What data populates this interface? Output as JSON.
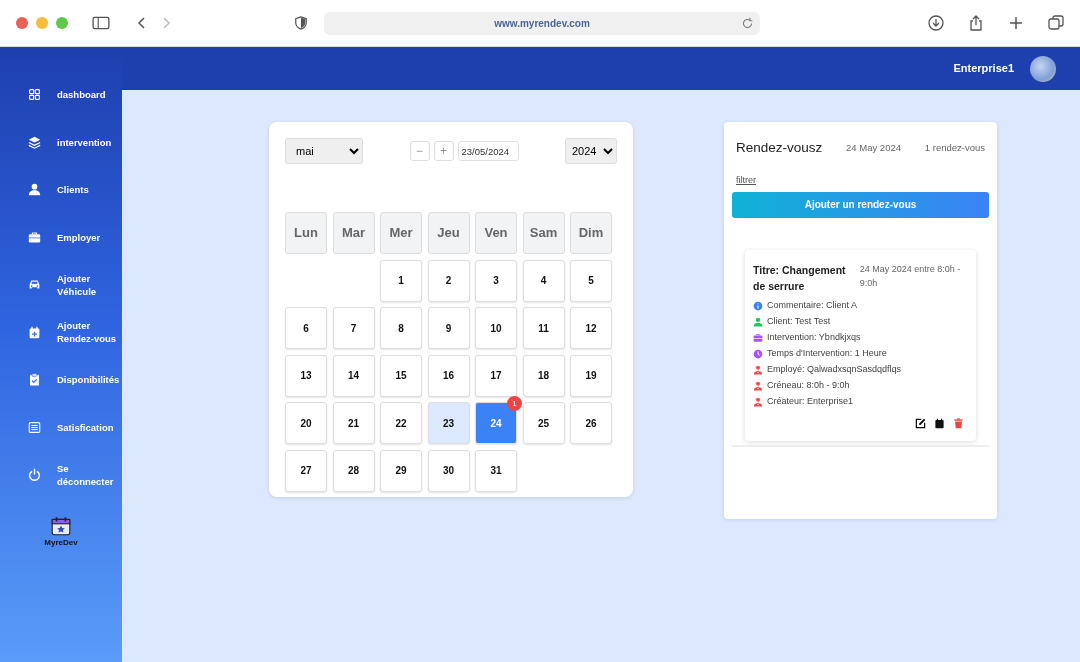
{
  "browser": {
    "url": "www.myrendev.com"
  },
  "header": {
    "user": "Enterprise1"
  },
  "sidebar": {
    "items": [
      {
        "label": "dashboard"
      },
      {
        "label": "intervention"
      },
      {
        "label": "Clients"
      },
      {
        "label": "Employer"
      },
      {
        "label": "Ajouter Véhicule"
      },
      {
        "label": "Ajouter Rendez-vous"
      },
      {
        "label": "Disponibilités"
      },
      {
        "label": "Satisfication"
      },
      {
        "label": "Se déconnecter"
      }
    ],
    "logo_text": "MyreDev"
  },
  "calendar": {
    "month": "mai",
    "date": "23/05/2024",
    "year": "2024",
    "minus": "−",
    "plus": "+",
    "weekdays": [
      "Lun",
      "Mar",
      "Mer",
      "Jeu",
      "Ven",
      "Sam",
      "Dim"
    ],
    "weeks": [
      [
        {
          "kind": "blank"
        },
        {
          "kind": "blank"
        },
        {
          "label": "1",
          "selected": false,
          "highlighted": false
        },
        {
          "label": "2",
          "selected": false,
          "highlighted": false
        },
        {
          "label": "3",
          "selected": false,
          "highlighted": false
        },
        {
          "label": "4",
          "selected": false,
          "highlighted": false
        },
        {
          "label": "5",
          "selected": false,
          "highlighted": false
        }
      ],
      [
        {
          "label": "6",
          "selected": false,
          "highlighted": false
        },
        {
          "label": "7",
          "selected": false,
          "highlighted": false
        },
        {
          "label": "8",
          "selected": false,
          "highlighted": false
        },
        {
          "label": "9",
          "selected": false,
          "highlighted": false
        },
        {
          "label": "10",
          "selected": false,
          "highlighted": false
        },
        {
          "label": "11",
          "selected": false,
          "highlighted": false
        },
        {
          "label": "12",
          "selected": false,
          "highlighted": false
        }
      ],
      [
        {
          "label": "13",
          "selected": false,
          "highlighted": false
        },
        {
          "label": "14",
          "selected": false,
          "highlighted": false
        },
        {
          "label": "15",
          "selected": false,
          "highlighted": false
        },
        {
          "label": "16",
          "selected": false,
          "highlighted": false
        },
        {
          "label": "17",
          "selected": false,
          "highlighted": false
        },
        {
          "label": "18",
          "selected": false,
          "highlighted": false
        },
        {
          "label": "19",
          "selected": false,
          "highlighted": false
        }
      ],
      [
        {
          "label": "20",
          "selected": false,
          "highlighted": false
        },
        {
          "label": "21",
          "selected": false,
          "highlighted": false
        },
        {
          "label": "22",
          "selected": false,
          "highlighted": false
        },
        {
          "label": "23",
          "selected": false,
          "highlighted": true
        },
        {
          "label": "24",
          "selected": true,
          "highlighted": false,
          "badge": "1"
        },
        {
          "label": "25",
          "selected": false,
          "highlighted": false
        },
        {
          "label": "26",
          "selected": false,
          "highlighted": false
        }
      ],
      [
        {
          "label": "27",
          "selected": false,
          "highlighted": false
        },
        {
          "label": "28",
          "selected": false,
          "highlighted": false
        },
        {
          "label": "29",
          "selected": false,
          "highlighted": false
        },
        {
          "label": "30",
          "selected": false,
          "highlighted": false
        },
        {
          "label": "31",
          "selected": false,
          "highlighted": false
        }
      ]
    ]
  },
  "appointments": {
    "title": "Rendez-vousz",
    "date": "24 May 2024",
    "count": "1 rendez-vous",
    "filter": "filtrer",
    "add_button": "Ajouter un rendez-vous",
    "items": [
      {
        "title": "Titre: Changement de serrure",
        "when": "24 May 2024 entre 8:0h - 9:0h",
        "details": [
          {
            "kind": "info",
            "color": "#3b82f6",
            "text": "Commentaire: Client A"
          },
          {
            "kind": "person",
            "color": "#22c55e",
            "text": "Client: Test Test"
          },
          {
            "kind": "briefcase",
            "color": "#a855f7",
            "text": "Intervention: Ybndkjxqs"
          },
          {
            "kind": "clock",
            "color": "#a855f7",
            "text": "Temps d'Intervention: 1 Heure"
          },
          {
            "kind": "worker",
            "color": "#ef4444",
            "text": "Employé: QalwadxsqnSasdqdflqs"
          },
          {
            "kind": "worker",
            "color": "#ef4444",
            "text": "Créneau: 8:0h - 9:0h"
          },
          {
            "kind": "worker",
            "color": "#ef4444",
            "text": "Créateur: Enterprise1"
          }
        ]
      }
    ]
  }
}
